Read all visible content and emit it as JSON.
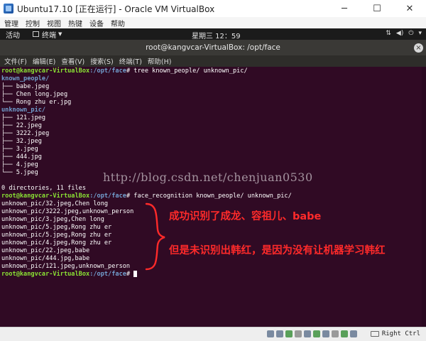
{
  "window": {
    "title": "Ubuntu17.10 [正在运行] - Oracle VM VirtualBox",
    "controls": {
      "minimize": "─",
      "maximize": "☐",
      "close": "✕"
    }
  },
  "vbox_menu": [
    "管理",
    "控制",
    "视图",
    "热键",
    "设备",
    "帮助"
  ],
  "gnome": {
    "activities": "活动",
    "app_menu": "终端",
    "clock": "星期三 12：59",
    "status_icons": [
      "network-icon",
      "volume-icon",
      "power-icon"
    ]
  },
  "terminal": {
    "title": "root@kangvcar-VirtualBox: /opt/face",
    "close": "×",
    "menu": [
      "文件(F)",
      "编辑(E)",
      "查看(V)",
      "搜索(S)",
      "终端(T)",
      "帮助(H)"
    ]
  },
  "prompt": {
    "user": "root@kangvcar-VirtualBox",
    "path": ":/opt/face",
    "symbol": "# "
  },
  "session": {
    "cmd1": "tree known_people/ unknown_pic/",
    "tree": [
      {
        "prefix": "",
        "name": "known_people/",
        "dir": true
      },
      {
        "prefix": "├── ",
        "name": "babe.jpeg",
        "dir": false
      },
      {
        "prefix": "├── ",
        "name": "Chen long.jpeg",
        "dir": false
      },
      {
        "prefix": "└── ",
        "name": "Rong zhu er.jpg",
        "dir": false
      },
      {
        "prefix": "",
        "name": "unknown_pic/",
        "dir": true
      },
      {
        "prefix": "├── ",
        "name": "121.jpeg",
        "dir": false
      },
      {
        "prefix": "├── ",
        "name": "22.jpeg",
        "dir": false
      },
      {
        "prefix": "├── ",
        "name": "3222.jpeg",
        "dir": false
      },
      {
        "prefix": "├── ",
        "name": "32.jpeg",
        "dir": false
      },
      {
        "prefix": "├── ",
        "name": "3.jpeg",
        "dir": false
      },
      {
        "prefix": "├── ",
        "name": "444.jpg",
        "dir": false
      },
      {
        "prefix": "├── ",
        "name": "4.jpeg",
        "dir": false
      },
      {
        "prefix": "└── ",
        "name": "5.jpeg",
        "dir": false
      }
    ],
    "summary": "0 directories, 11 files",
    "cmd2": "face_recognition known_people/ unknown_pic/",
    "results": [
      "unknown_pic/32.jpeg,Chen long",
      "unknown_pic/3222.jpeg,unknown_person",
      "unknown_pic/3.jpeg,Chen long",
      "unknown_pic/5.jpeg,Rong zhu er",
      "unknown_pic/5.jpeg,Rong zhu er",
      "unknown_pic/4.jpeg,Rong zhu er",
      "unknown_pic/22.jpeg,babe",
      "unknown_pic/444.jpg,babe",
      "unknown_pic/121.jpeg,unknown_person"
    ]
  },
  "overlay": {
    "watermark": "http://blog.csdn.net/chenjuan0530",
    "annotation_1": "成功识别了成龙、容祖儿、babe",
    "annotation_2": "但是未识别出韩红，是因为没有让机器学习韩红",
    "annotation_color": "#ff2a2a"
  },
  "statusbar": {
    "host_key": "Right Ctrl"
  },
  "colors": {
    "terminal_bg": "#300a24",
    "prompt_user": "#8ae234",
    "prompt_path": "#729fcf",
    "directory": "#729fcf"
  }
}
